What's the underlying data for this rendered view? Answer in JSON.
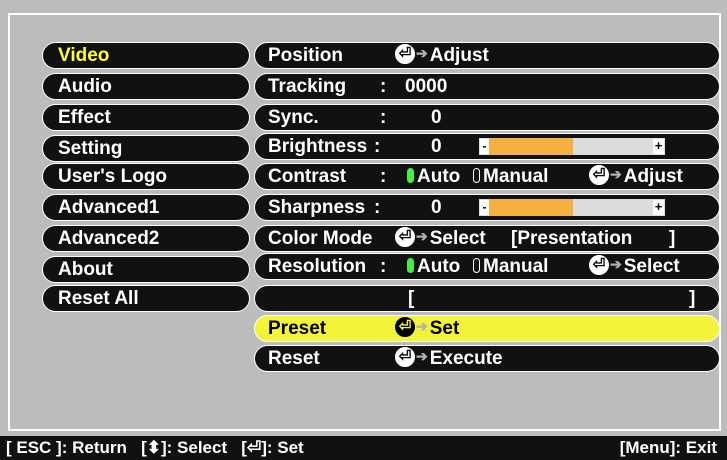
{
  "menu": {
    "items": [
      {
        "label": "Video",
        "active": true
      },
      {
        "label": "Audio"
      },
      {
        "label": "Effect"
      },
      {
        "label": "Setting"
      },
      {
        "label": "User's Logo"
      },
      {
        "label": "Advanced1"
      },
      {
        "label": "Advanced2"
      },
      {
        "label": "About"
      },
      {
        "label": "Reset All"
      }
    ]
  },
  "rows": {
    "position": {
      "label": "Position",
      "action": "Adjust"
    },
    "tracking": {
      "label": "Tracking",
      "colon": ":",
      "value": "0000"
    },
    "sync": {
      "label": "Sync.",
      "colon": ":",
      "value": "0"
    },
    "brightness": {
      "label": "Brightness",
      "colon": ":",
      "value": "0",
      "level": 0.51
    },
    "contrast": {
      "label": "Contrast",
      "colon": ":",
      "auto": "Auto",
      "manual": "Manual",
      "action": "Adjust"
    },
    "sharpness": {
      "label": "Sharpness",
      "colon": ":",
      "value": "0",
      "level": 0.51
    },
    "color_mode": {
      "label": "Color Mode",
      "action": "Select",
      "value": "[Presentation",
      "bracket_close": "]"
    },
    "resolution": {
      "label": "Resolution",
      "colon": ":",
      "auto": "Auto",
      "manual": "Manual",
      "action": "Select"
    },
    "blank": {
      "open": "[",
      "close": "]"
    },
    "preset": {
      "label": "Preset",
      "action": "Set"
    },
    "reset": {
      "label": "Reset",
      "action": "Execute"
    }
  },
  "status": {
    "esc": "[ ESC ]: Return",
    "select_prefix": "[",
    "select_icon": "⬍",
    "select_suffix": "]: Select",
    "set_prefix": "[",
    "set_suffix": "]: Set",
    "menu_exit": "[Menu]: Exit"
  },
  "icons": {
    "enter": "enter-button-icon",
    "arrow": "right-arrow-icon",
    "updown": "up-down-arrow-icon"
  },
  "colors": {
    "background": "#bcbcbc",
    "pill": "#111111",
    "active_text": "#ffff33",
    "selected_row": "#f3f33a",
    "slider_fill": "#f5b041",
    "radio_on": "#44ee44"
  }
}
